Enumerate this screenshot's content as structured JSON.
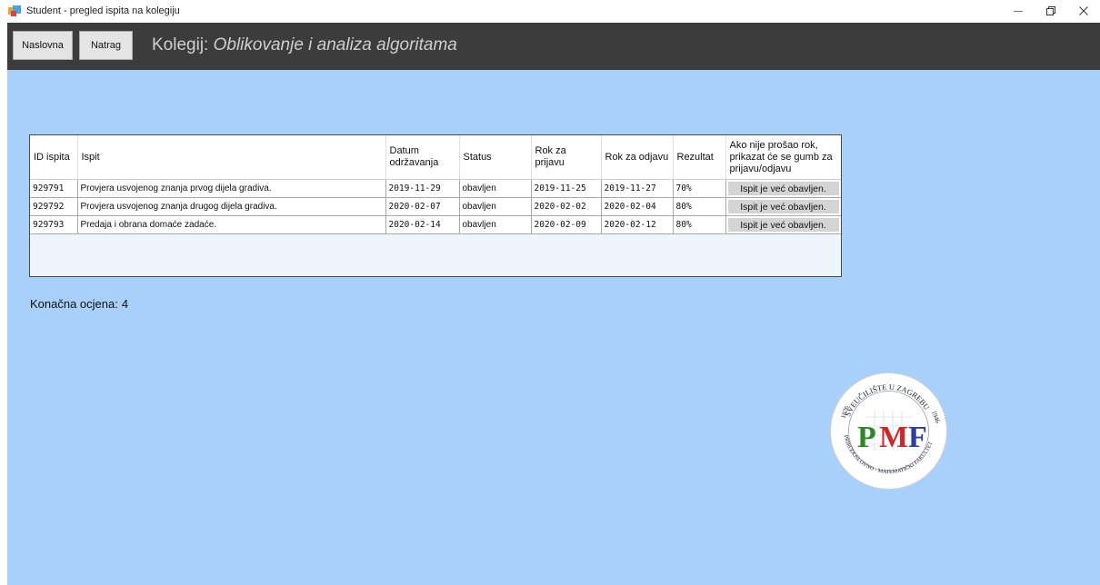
{
  "window": {
    "title": "Student - pregled ispita na kolegiju",
    "minimize_symbol": "—",
    "icons": [
      "app-icon",
      "minimize-icon",
      "restore-icon",
      "close-icon"
    ]
  },
  "header": {
    "home_label": "Naslovna",
    "back_label": "Natrag",
    "course_prefix": "Kolegij:",
    "course_name": "Oblikovanje i analiza algoritama"
  },
  "table": {
    "columns": [
      "ID ispita",
      "Ispit",
      "Datum održavanja",
      "Status",
      "Rok za prijavu",
      "Rok za odjavu",
      "Rezultat",
      "Ako nije prošao rok, prikazat će se gumb za prijavu/odjavu"
    ],
    "rows": [
      {
        "id": "929791",
        "ispit": "Provjera usvojenog znanja prvog dijela gradiva.",
        "datum": "2019-11-29",
        "status": "obavljen",
        "rok_prijava": "2019-11-25",
        "rok_odjava": "2019-11-27",
        "rezultat": "70%",
        "akcija": "Ispit je već obavljen."
      },
      {
        "id": "929792",
        "ispit": "Provjera usvojenog znanja drugog dijela gradiva.",
        "datum": "2020-02-07",
        "status": "obavljen",
        "rok_prijava": "2020-02-02",
        "rok_odjava": "2020-02-04",
        "rezultat": "80%",
        "akcija": "Ispit je već obavljen."
      },
      {
        "id": "929793",
        "ispit": "Predaja i obrana domaće zadaće.",
        "datum": "2020-02-14",
        "status": "obavljen",
        "rok_prijava": "2020-02-09",
        "rok_odjava": "2020-02-12",
        "rezultat": "80%",
        "akcija": "Ispit je već obavljen."
      }
    ]
  },
  "final_grade": {
    "label": "Konačna ocjena:",
    "value": "4"
  },
  "logo": {
    "top_text": "SVEUČILIŠTE U ZAGREBU",
    "bottom_text": "PRIRODOSLOVNO - MATEMATIČKI FAKULTET",
    "year_left": "1876",
    "year_right": "1946",
    "letter_p": "P",
    "letter_m": "M",
    "letter_f": "F",
    "colors": {
      "p": "#2a8a2a",
      "m": "#cc2a2a",
      "f": "#2a3fa0"
    }
  },
  "colors": {
    "background": "#a8d0fb",
    "header": "#3c3c3c",
    "button_gray": "#d4d4d4"
  }
}
